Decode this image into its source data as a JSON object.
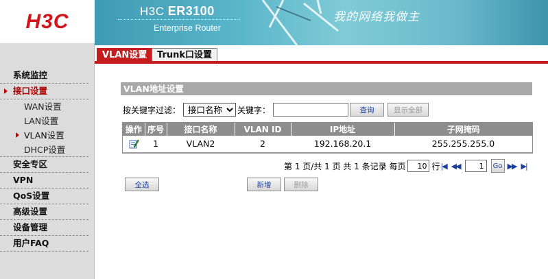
{
  "brand": {
    "logo": "H3C",
    "model_prefix": "H3C",
    "model": "ER3100",
    "subtitle": "Enterprise Router",
    "slogan": "我的网络我做主"
  },
  "sidebar": {
    "items": [
      {
        "label": "系统监控"
      },
      {
        "label": "接口设置"
      },
      {
        "label": "WAN设置"
      },
      {
        "label": "LAN设置"
      },
      {
        "label": "VLAN设置"
      },
      {
        "label": "DHCP设置"
      },
      {
        "label": "安全专区"
      },
      {
        "label": "VPN"
      },
      {
        "label": "QoS设置"
      },
      {
        "label": "高级设置"
      },
      {
        "label": "设备管理"
      },
      {
        "label": "用户FAQ"
      }
    ]
  },
  "tabs": [
    {
      "label": "VLAN设置"
    },
    {
      "label": "Trunk口设置"
    }
  ],
  "section": {
    "title": "VLAN地址设置"
  },
  "filter": {
    "label": "按关键字过滤：",
    "select_value": "接口名称",
    "keyword_label": "关键字：",
    "keyword_value": "",
    "query_label": "查询",
    "show_all_label": "显示全部"
  },
  "table": {
    "headers": [
      "操作",
      "序号",
      "接口名称",
      "VLAN ID",
      "IP地址",
      "子网掩码"
    ],
    "rows": [
      {
        "index": "1",
        "name": "VLAN2",
        "vlan_id": "2",
        "ip": "192.168.20.1",
        "mask": "255.255.255.0"
      }
    ]
  },
  "pager": {
    "summary": "第 1 页/共 1 页 共 1 条记录 每页",
    "per_page": "10",
    "row_suffix": "行",
    "page": "1",
    "go_label": "Go"
  },
  "actions": {
    "select_all": "全选",
    "add": "新增",
    "delete": "删除"
  },
  "icons": {
    "edit": "edit-icon"
  },
  "colors": {
    "accent": "#c51d1d",
    "logo": "#d4141b",
    "header_bg": "#a8a8a8",
    "link": "#1a3ea0"
  }
}
